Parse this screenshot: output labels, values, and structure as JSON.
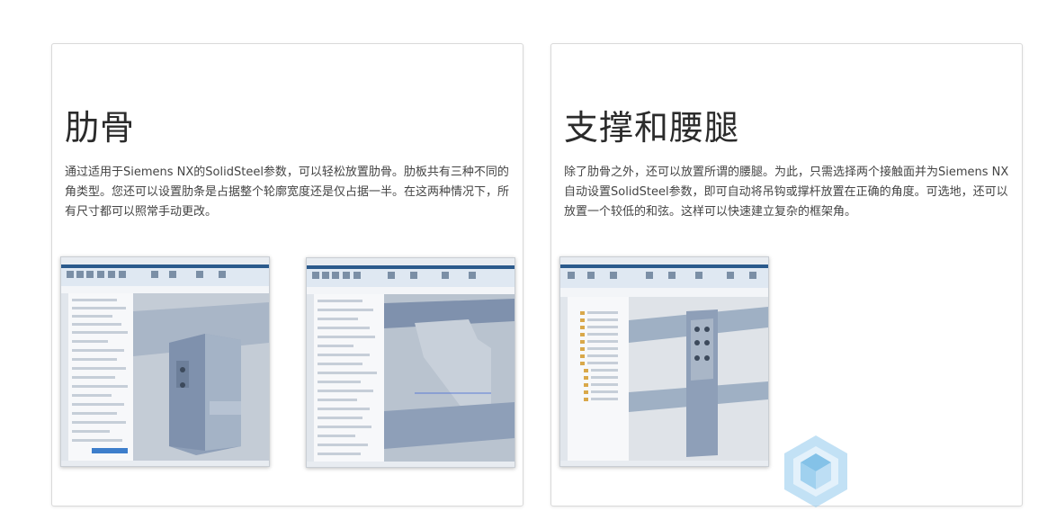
{
  "cards": [
    {
      "title": "肋骨",
      "body": "通过适用于Siemens NX的SolidSteel参数，可以轻松放置肋骨。肋板共有三种不同的角类型。您还可以设置肋条是占据整个轮廓宽度还是仅占据一半。在这两种情况下，所有尺寸都可以照常手动更改。"
    },
    {
      "title": "支撑和腰腿",
      "body": "除了肋骨之外，还可以放置所谓的腰腿。为此，只需选择两个接触面并为Siemens NX自动设置SolidSteel参数，即可自动将吊钩或撑杆放置在正确的角度。可选地，还可以放置一个较低的和弦。这样可以快速建立复杂的框架角。"
    }
  ],
  "screenshots": [
    {
      "description_icon": "nx-rib-dialog-screenshot"
    },
    {
      "description_icon": "nx-rib-detail-screenshot"
    },
    {
      "description_icon": "nx-haunch-tree-screenshot"
    }
  ],
  "colors": {
    "nx_ribbon": "#dfe8f2",
    "nx_titlebar": "#2b5a8c",
    "model_steel": "#8e9fb8",
    "model_background": "#b9c3cf",
    "watermark": "#8fc9ec"
  }
}
